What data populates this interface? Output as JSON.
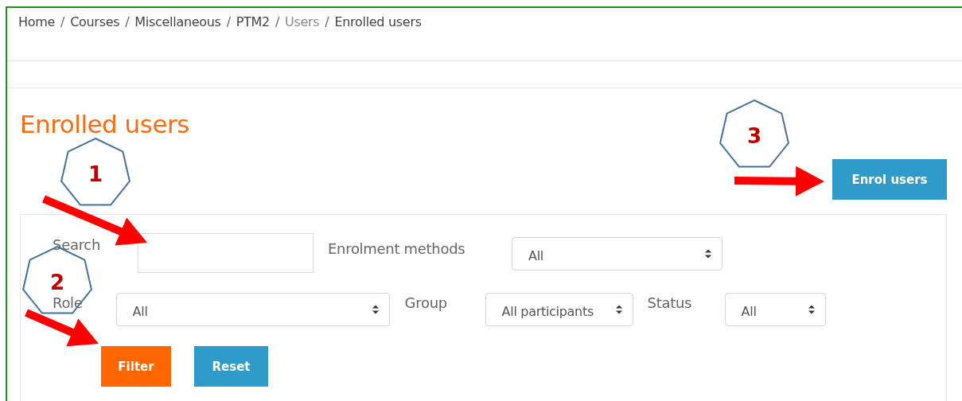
{
  "breadcrumb": [
    {
      "label": "Home",
      "muted": false
    },
    {
      "label": "Courses",
      "muted": false
    },
    {
      "label": "Miscellaneous",
      "muted": false
    },
    {
      "label": "PTM2",
      "muted": false
    },
    {
      "label": "Users",
      "muted": true
    },
    {
      "label": "Enrolled users",
      "muted": false
    }
  ],
  "separator": "/",
  "heading": "Enrolled users",
  "enrol_button": "Enrol users",
  "filters": {
    "search": {
      "label": "Search"
    },
    "enrolment_methods": {
      "label": "Enrolment methods",
      "value": "All"
    },
    "role": {
      "label": "Role",
      "value": "All"
    },
    "group": {
      "label": "Group",
      "value": "All participants"
    },
    "status": {
      "label": "Status",
      "value": "All"
    }
  },
  "buttons": [
    {
      "label": "Filter",
      "kind": "primary"
    },
    {
      "label": "Reset",
      "kind": "secondary"
    }
  ],
  "callouts": [
    {
      "number": "1"
    },
    {
      "number": "2"
    },
    {
      "number": "3"
    }
  ]
}
